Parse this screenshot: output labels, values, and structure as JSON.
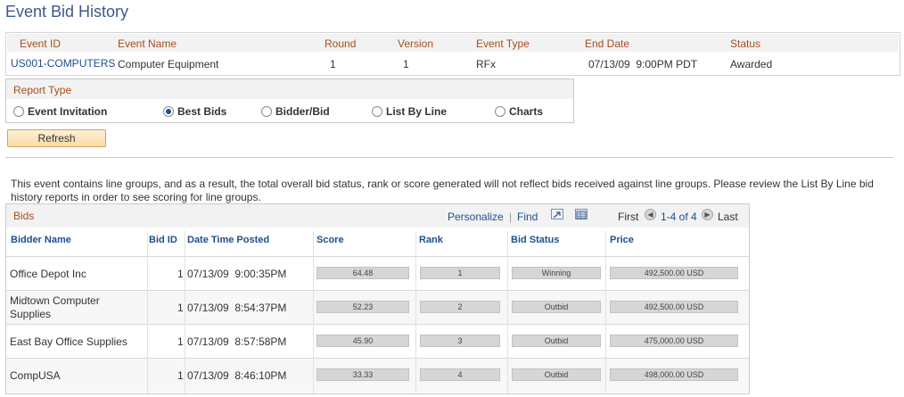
{
  "page": {
    "title": "Event Bid History"
  },
  "event": {
    "headers": [
      "Event ID",
      "Event Name",
      "Round",
      "Version",
      "Event Type",
      "End Date",
      "Status"
    ],
    "values": {
      "event_id": "US001-COMPUTERS",
      "event_name": "Computer Equipment",
      "round": "1",
      "version": "1",
      "event_type": "RFx",
      "end_date": "07/13/09  9:00PM PDT",
      "status": "Awarded"
    }
  },
  "report_type": {
    "title": "Report Type",
    "options": [
      {
        "label": "Event Invitation",
        "checked": false
      },
      {
        "label": "Best Bids",
        "checked": true
      },
      {
        "label": "Bidder/Bid",
        "checked": false
      },
      {
        "label": "List By Line",
        "checked": false
      },
      {
        "label": "Charts",
        "checked": false
      }
    ]
  },
  "refresh_label": "Refresh",
  "notice": "This event contains line groups, and as a result, the total overall bid status, rank or score generated will not reflect bids received against line groups.  Please review the List By Line bid history reports in order to see scoring for line groups.",
  "bids": {
    "title": "Bids",
    "personalize": "Personalize",
    "find": "Find",
    "first": "First",
    "range": "1-4 of 4",
    "last": "Last",
    "columns": [
      "Bidder Name",
      "Bid ID",
      "Date Time Posted",
      "Score",
      "Rank",
      "Bid Status",
      "Price"
    ],
    "rows": [
      {
        "bidder": "Office Depot Inc",
        "bid_id": "1",
        "posted": "07/13/09  9:00:35PM",
        "score": "64.48",
        "rank": "1",
        "status": "Winning",
        "price": "492,500.00 USD"
      },
      {
        "bidder": "Midtown Computer Supplies",
        "bid_id": "1",
        "posted": "07/13/09  8:54:37PM",
        "score": "52.23",
        "rank": "2",
        "status": "Outbid",
        "price": "492,500.00 USD"
      },
      {
        "bidder": "East Bay Office Supplies",
        "bid_id": "1",
        "posted": "07/13/09  8:57:58PM",
        "score": "45.90",
        "rank": "3",
        "status": "Outbid",
        "price": "475,000.00 USD"
      },
      {
        "bidder": "CompUSA",
        "bid_id": "1",
        "posted": "07/13/09  8:46:10PM",
        "score": "33.33",
        "rank": "4",
        "status": "Outbid",
        "price": "498,000.00 USD"
      }
    ]
  },
  "icons": [
    "view-all-icon",
    "download-icon",
    "previous-icon",
    "next-icon"
  ]
}
